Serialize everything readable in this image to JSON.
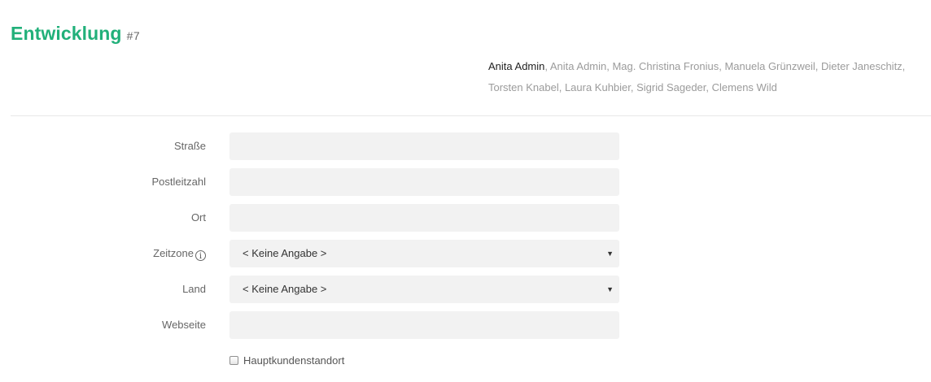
{
  "header": {
    "title": "Entwicklung",
    "number": "#7"
  },
  "members": {
    "active": "Anita Admin",
    "others": ", Anita Admin, Mag. Christina Fronius, Manuela Grünzweil, Dieter Janeschitz, Torsten Knabel, Laura Kuhbier, Sigrid Sageder, Clemens Wild"
  },
  "form": {
    "street": {
      "label": "Straße",
      "value": ""
    },
    "postal_code": {
      "label": "Postleitzahl",
      "value": ""
    },
    "city": {
      "label": "Ort",
      "value": ""
    },
    "timezone": {
      "label": "Zeitzone",
      "selected": "< Keine Angabe >",
      "info_icon": "info-icon"
    },
    "country": {
      "label": "Land",
      "selected": "< Keine Angabe >"
    },
    "website": {
      "label": "Webseite",
      "value": ""
    },
    "main_location": {
      "label": "Hauptkundenstandort",
      "checked": false
    }
  },
  "colors": {
    "accent": "#21b07a",
    "field_background": "#f2f2f2",
    "muted_text": "#9b9b9b"
  }
}
